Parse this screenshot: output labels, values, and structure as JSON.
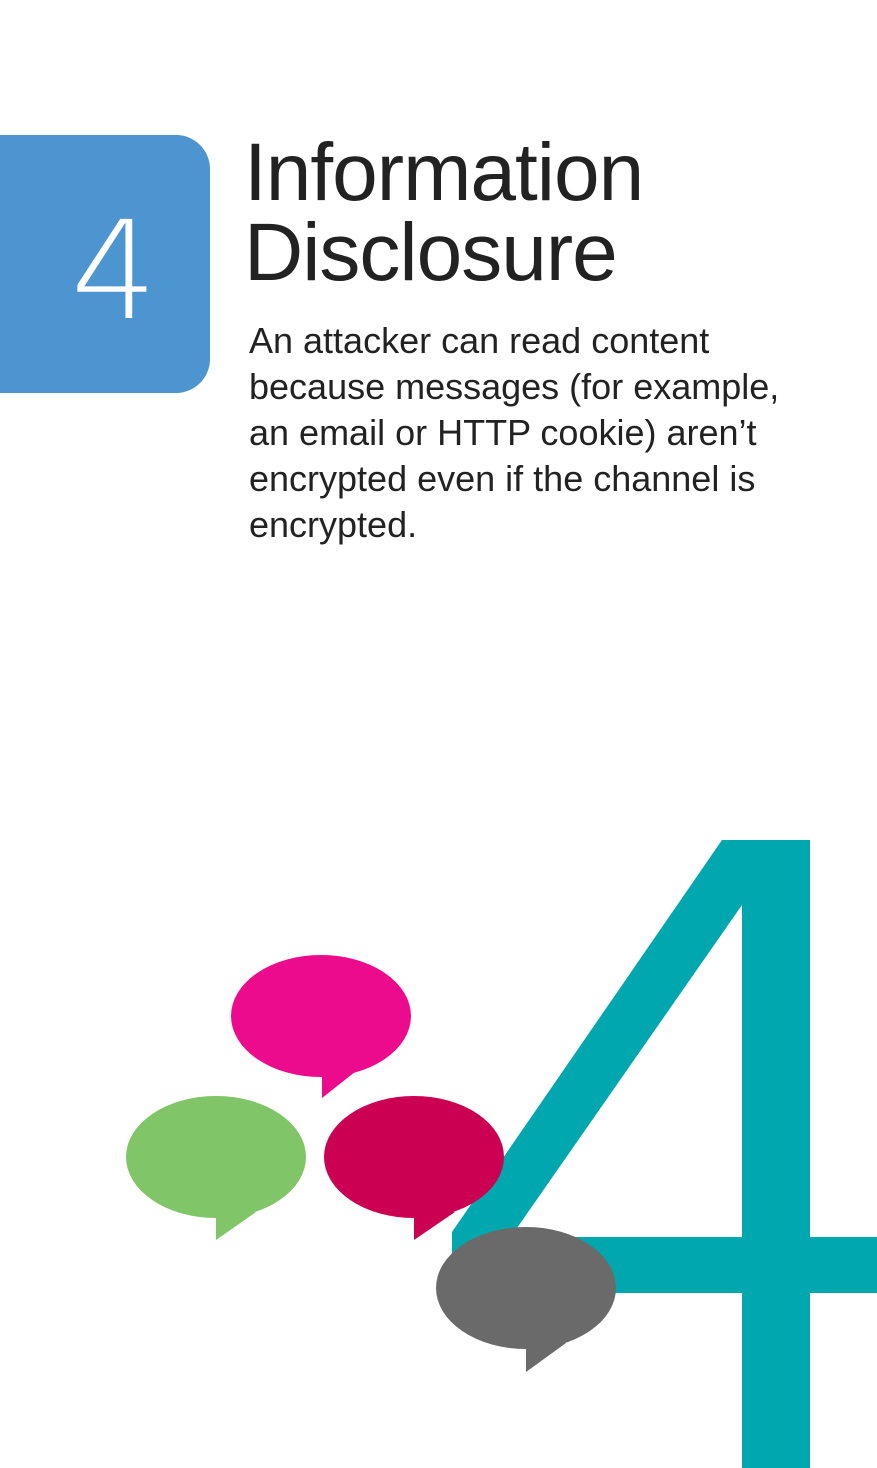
{
  "card": {
    "number": "4",
    "title_line1": "Information",
    "title_line2": "Disclosure",
    "description": "An attacker can read content because messages (for example, an email or HTTP cookie) aren’t encrypted even if the channel is encrypted.",
    "big_numeral": "4"
  },
  "colors": {
    "tab": "#4c95d0",
    "numeral": "#00a7af",
    "bubble_pink": "#ec0b8c",
    "bubble_green": "#80c568",
    "bubble_crimson": "#cc0052",
    "bubble_gray": "#6b6a6a"
  },
  "illustration": {
    "icon": "speech-bubbles-icon"
  }
}
